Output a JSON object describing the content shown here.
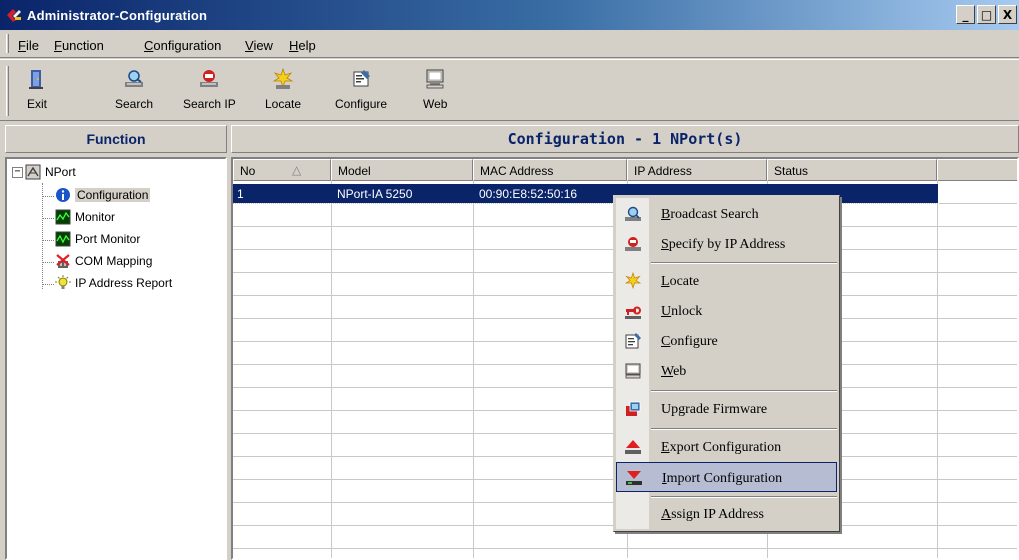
{
  "window": {
    "title": "Administrator-Configuration",
    "min": "_",
    "max": "□",
    "close": "X"
  },
  "menubar": {
    "items": [
      {
        "accel": "F",
        "rest": "ile"
      },
      {
        "accel": "F",
        "rest": "unction"
      },
      {
        "accel": "C",
        "rest": "onfiguration"
      },
      {
        "accel": "V",
        "rest": "iew"
      },
      {
        "accel": "H",
        "rest": "elp"
      }
    ]
  },
  "toolbar": {
    "exit": "Exit",
    "search": "Search",
    "search_ip": "Search IP",
    "locate": "Locate",
    "configure": "Configure",
    "web": "Web"
  },
  "function_pane": {
    "header": "Function",
    "root": "NPort",
    "expander": "−",
    "nodes": [
      "Configuration",
      "Monitor",
      "Port Monitor",
      "COM Mapping",
      "IP Address Report"
    ]
  },
  "config_pane": {
    "header": "Configuration - 1 NPort(s)",
    "columns": [
      "No",
      "Model",
      "MAC Address",
      "IP Address",
      "Status"
    ],
    "sort_indicator": "△",
    "rows": [
      {
        "no": "1",
        "model": "NPort-IA 5250",
        "mac": "00:90:E8:52:50:16"
      }
    ]
  },
  "context_menu": {
    "items": [
      {
        "accel": "B",
        "rest": "roadcast Search"
      },
      {
        "accel": "S",
        "rest": "pecify by IP Address"
      },
      {
        "accel": "L",
        "rest": "ocate"
      },
      {
        "accel": "U",
        "rest": "nlock"
      },
      {
        "accel": "C",
        "rest": "onfigure"
      },
      {
        "accel": "W",
        "rest": "eb"
      },
      {
        "pre": "Up",
        "accel": "g",
        "rest": "rade Firmware"
      },
      {
        "accel": "E",
        "rest": "xport Configuration"
      },
      {
        "accel": "I",
        "rest": "mport Configuration"
      },
      {
        "accel": "A",
        "rest": "ssign IP Address"
      }
    ]
  },
  "colors": {
    "titlebar_start": "#0a246a",
    "titlebar_end": "#a6caf0",
    "selection": "#0a246a",
    "menu_highlight": "#b6bdd2",
    "panel_bg": "#d4d0c8"
  }
}
